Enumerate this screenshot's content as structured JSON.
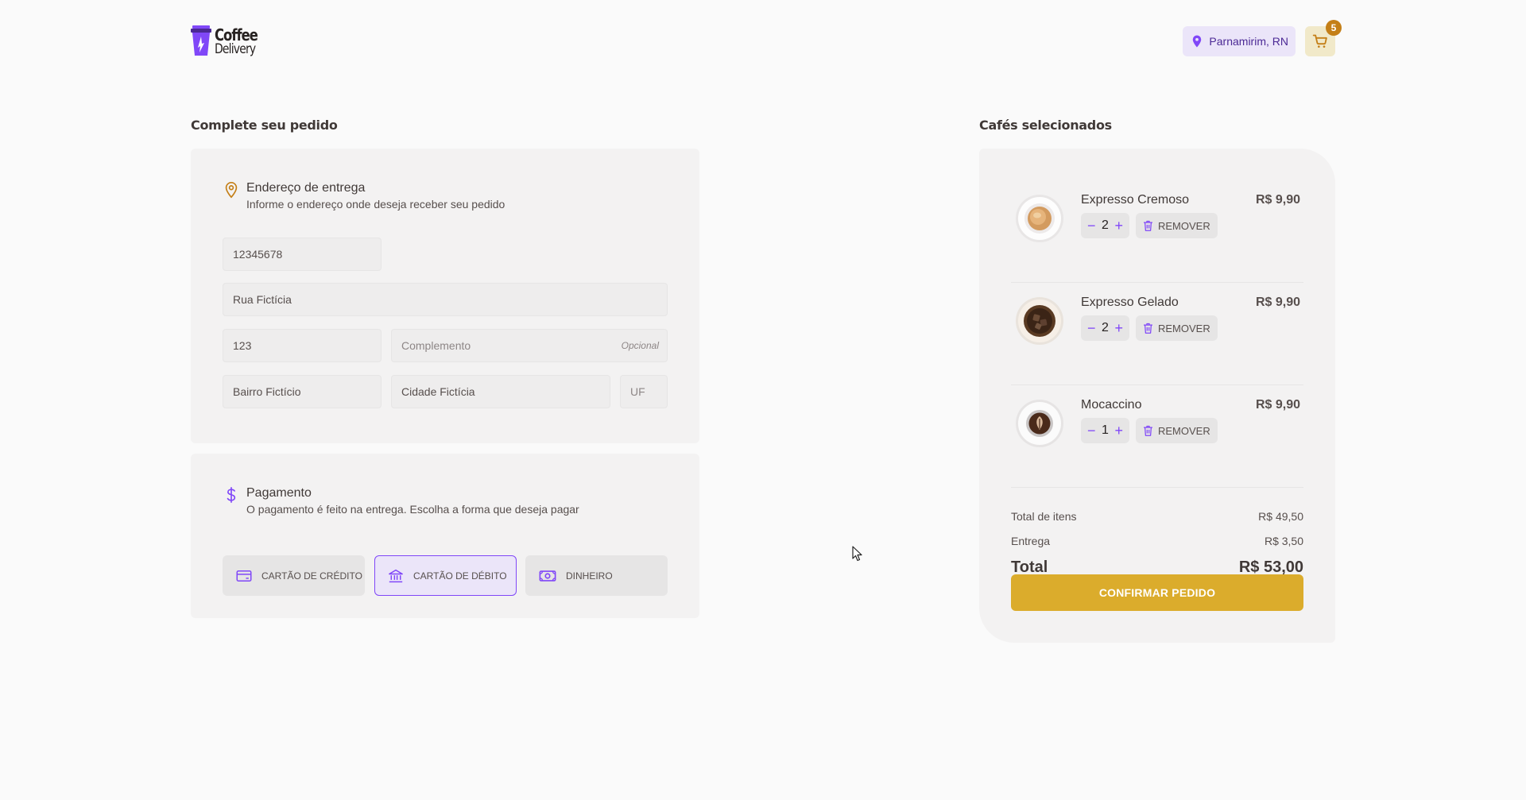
{
  "brand": {
    "line1": "Coffee",
    "line2": "Delivery"
  },
  "header": {
    "location": "Parnamirim, RN",
    "cart_count": "5"
  },
  "checkout": {
    "title": "Complete seu pedido",
    "address": {
      "heading": "Endereço de entrega",
      "subheading": "Informe o endereço onde deseja receber seu pedido",
      "cep": "12345678",
      "rua": "Rua Fictícia",
      "numero": "123",
      "complemento_placeholder": "Complemento",
      "complemento_optional": "Opcional",
      "bairro": "Bairro Fictício",
      "cidade": "Cidade Fictícia",
      "uf_placeholder": "UF"
    },
    "payment": {
      "heading": "Pagamento",
      "subheading": "O pagamento é feito na entrega. Escolha a forma que deseja pagar",
      "options": [
        {
          "label": "CARTÃO DE CRÉDITO",
          "icon": "credit-card-icon",
          "selected": false
        },
        {
          "label": "CARTÃO DE DÉBITO",
          "icon": "bank-icon",
          "selected": true
        },
        {
          "label": "DINHEIRO",
          "icon": "money-icon",
          "selected": false
        }
      ]
    }
  },
  "cart": {
    "title": "Cafés selecionados",
    "remove_label": "REMOVER",
    "items": [
      {
        "name": "Expresso Cremoso",
        "price": "R$ 9,90",
        "quantity": "2"
      },
      {
        "name": "Expresso Gelado",
        "price": "R$ 9,90",
        "quantity": "2"
      },
      {
        "name": "Mocaccino",
        "price": "R$ 9,90",
        "quantity": "1"
      }
    ],
    "totals": {
      "items_label": "Total de itens",
      "items_value": "R$ 49,50",
      "delivery_label": "Entrega",
      "delivery_value": "R$ 3,50",
      "total_label": "Total",
      "total_value": "R$ 53,00"
    },
    "confirm_label": "CONFIRMAR PEDIDO"
  },
  "colors": {
    "purple": "#8047F8",
    "purple_dark": "#4B2995",
    "yellow": "#DBAC2C",
    "yellow_dark": "#C47F17"
  }
}
